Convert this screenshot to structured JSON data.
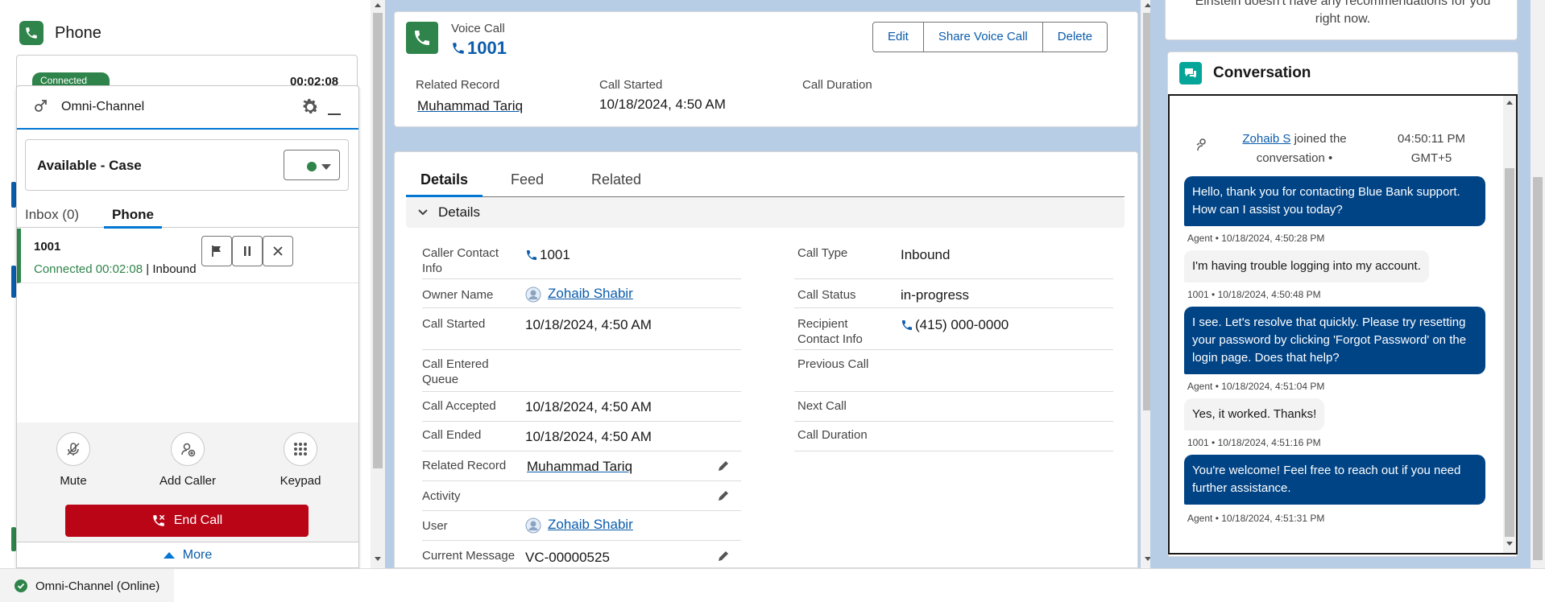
{
  "phone": {
    "title": "Phone",
    "background_badge": "Connected",
    "background_timer": "00:02:08"
  },
  "omni": {
    "title": "Omni-Channel",
    "status": "Available - Case",
    "tabs": {
      "inbox": "Inbox (0)",
      "phone": "Phone"
    },
    "work_item": {
      "number": "1001",
      "status_prefix": "Connected 00:02:08",
      "separator": " | ",
      "direction": "Inbound"
    },
    "controls": {
      "mute": "Mute",
      "add_caller": "Add Caller",
      "keypad": "Keypad"
    },
    "end_call": "End Call",
    "more": "More"
  },
  "footer": {
    "status": "Omni-Channel (Online)"
  },
  "record": {
    "type": "Voice Call",
    "name": "1001",
    "buttons": {
      "edit": "Edit",
      "share": "Share Voice Call",
      "delete": "Delete"
    },
    "highlights": {
      "related_record_label": "Related Record",
      "related_record_value": "Muhammad Tariq",
      "call_started_label": "Call Started",
      "call_started_value": "10/18/2024, 4:50 AM",
      "call_duration_label": "Call Duration"
    },
    "tabs": {
      "details": "Details",
      "feed": "Feed",
      "related": "Related"
    },
    "section": "Details",
    "fields_left": {
      "caller_contact_label": "Caller Contact Info",
      "caller_contact_value": "1001",
      "owner_label": "Owner Name",
      "owner_value": "Zohaib Shabir",
      "call_started_label": "Call Started",
      "call_started_value": "10/18/2024, 4:50 AM",
      "entered_queue_label": "Call Entered Queue",
      "accepted_label": "Call Accepted",
      "accepted_value": "10/18/2024, 4:50 AM",
      "ended_label": "Call Ended",
      "ended_value": "10/18/2024, 4:50 AM",
      "related_label": "Related Record",
      "related_value": "Muhammad Tariq",
      "activity_label": "Activity",
      "user_label": "User",
      "user_value": "Zohaib Shabir",
      "current_message_label": "Current Message",
      "current_message_value": "VC-00000525"
    },
    "fields_right": {
      "call_type_label": "Call Type",
      "call_type_value": "Inbound",
      "call_status_label": "Call Status",
      "call_status_value": "in-progress",
      "recipient_label": "Recipient Contact Info",
      "recipient_value": "(415) 000-0000",
      "previous_label": "Previous Call",
      "next_label": "Next Call",
      "duration_label": "Call Duration"
    }
  },
  "einstein": {
    "text": "Einstein doesn't have any recommendations for you right now."
  },
  "conversation": {
    "title": "Conversation",
    "join_name": "Zohaib S",
    "join_text": " joined the conversation •",
    "join_time": "04:50:11 PM GMT+5",
    "messages": [
      {
        "text": "Hello, thank you for contacting Blue Bank support. How can I assist you today?",
        "meta": "Agent • 10/18/2024, 4:50:28 PM"
      },
      {
        "text": "I'm having trouble logging into my account.",
        "meta": "1001 • 10/18/2024, 4:50:48 PM"
      },
      {
        "text": "I see. Let's resolve that quickly. Please try resetting your password by clicking 'Forgot Password' on the login page. Does that help?",
        "meta": "Agent • 10/18/2024, 4:51:04 PM"
      },
      {
        "text": "Yes, it worked. Thanks!",
        "meta": "1001 • 10/18/2024, 4:51:16 PM"
      },
      {
        "text": "You're welcome! Feel free to reach out if you need further assistance.",
        "meta": "Agent • 10/18/2024, 4:51:31 PM"
      }
    ]
  },
  "colors": {
    "brand_blue": "#0b5cab",
    "accent_blue": "#0176d3",
    "success_green": "#2e844a",
    "end_call_red": "#ba0517",
    "agent_bubble": "#014486",
    "conversation_icon": "#06a59a"
  }
}
